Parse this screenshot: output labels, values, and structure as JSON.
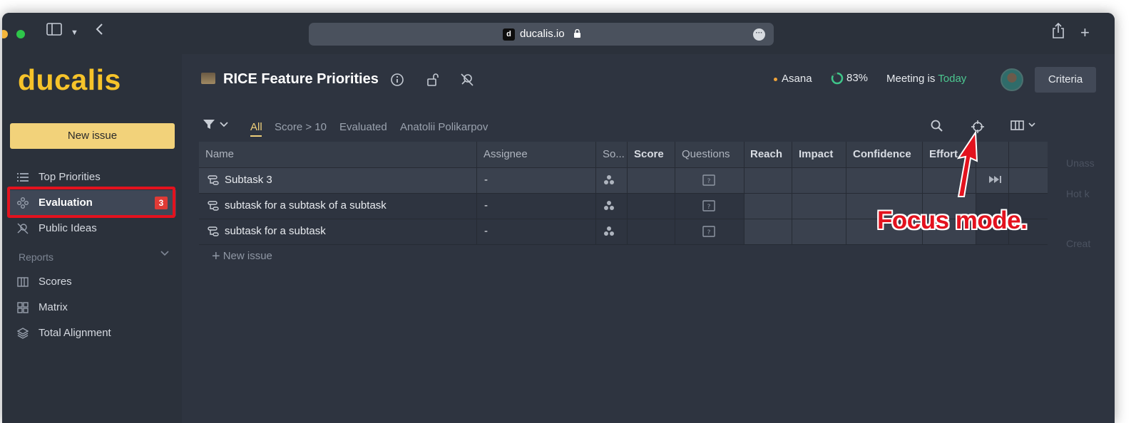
{
  "browser": {
    "url": "ducalis.io"
  },
  "sidebar": {
    "logo": "ducalis",
    "new_issue": "New issue",
    "items": [
      {
        "label": "Top Priorities",
        "icon": "list-icon"
      },
      {
        "label": "Evaluation",
        "icon": "evaluation-icon",
        "badge": "3",
        "active": true
      },
      {
        "label": "Public Ideas",
        "icon": "public-ideas-icon"
      }
    ],
    "reports_label": "Reports",
    "reports": [
      {
        "label": "Scores",
        "icon": "columns-icon"
      },
      {
        "label": "Matrix",
        "icon": "grid-icon"
      },
      {
        "label": "Total Alignment",
        "icon": "layers-icon"
      }
    ]
  },
  "header": {
    "title": "RICE Feature Priorities",
    "integration": "Asana",
    "progress": "83%",
    "progress_value": 0.83,
    "meeting_prefix": "Meeting is ",
    "meeting_when": "Today",
    "criteria": "Criteria"
  },
  "filters": {
    "tabs": [
      "All",
      "Score > 10",
      "Evaluated",
      "Anatolii Polikarpov"
    ]
  },
  "table": {
    "columns": [
      "Name",
      "Assignee",
      "So...",
      "Score",
      "Questions",
      "Reach",
      "Impact",
      "Confidence",
      "Effort"
    ],
    "rows": [
      {
        "name": "Subtask 3",
        "assignee": "-"
      },
      {
        "name": "subtask for a subtask of a subtask",
        "assignee": "-"
      },
      {
        "name": "subtask for a subtask",
        "assignee": "-"
      }
    ],
    "new_issue": "New issue"
  },
  "panel_ghost": {
    "unassigned": "Unass",
    "hotkeys": "Hot k",
    "created": "Creat"
  },
  "annotation": {
    "text": "Focus mode.",
    "color": "#e3121e"
  },
  "colors": {
    "accent": "#f6c32a",
    "button": "#f2d27a",
    "today": "#4cc790",
    "badge": "#e03b36"
  }
}
